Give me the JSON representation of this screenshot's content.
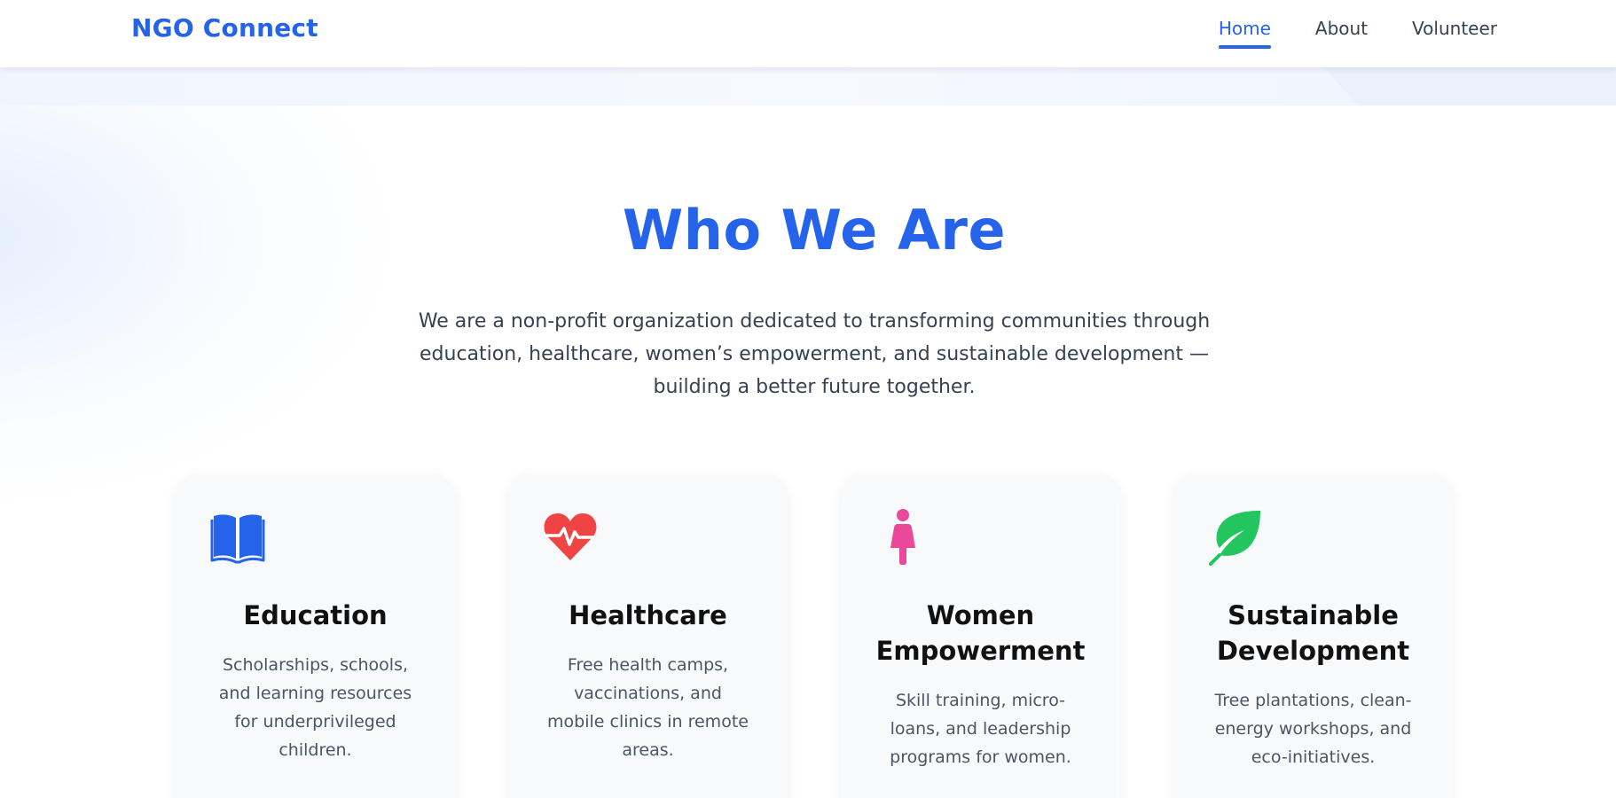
{
  "header": {
    "brand": "NGO Connect",
    "nav": [
      {
        "label": "Home",
        "active": true
      },
      {
        "label": "About",
        "active": false
      },
      {
        "label": "Volunteer",
        "active": false
      }
    ]
  },
  "hero": {
    "title": "Who We Are",
    "description": "We are a non-profit organization dedicated to transforming communities through education, healthcare, women’s empowerment, and sustainable development — building a better future together."
  },
  "cards": [
    {
      "icon": "book-icon",
      "icon_color": "#2563eb",
      "title": "Education",
      "description": "Scholarships, schools, and learning resources for underprivileged children."
    },
    {
      "icon": "heartbeat-icon",
      "icon_color": "#ef4444",
      "title": "Healthcare",
      "description": "Free health camps, vaccinations, and mobile clinics in remote areas."
    },
    {
      "icon": "female-icon",
      "icon_color": "#ec4899",
      "title": "Women Empowerment",
      "description": "Skill training, micro-loans, and leadership programs for women."
    },
    {
      "icon": "leaf-icon",
      "icon_color": "#22c55e",
      "title": "Sustainable Development",
      "description": "Tree plantations, clean-energy workshops, and eco-initiatives."
    }
  ],
  "colors": {
    "brand": "#2563eb",
    "nav_text": "#374151",
    "body_text": "#374151",
    "card_bg": "#f8f9fb"
  }
}
